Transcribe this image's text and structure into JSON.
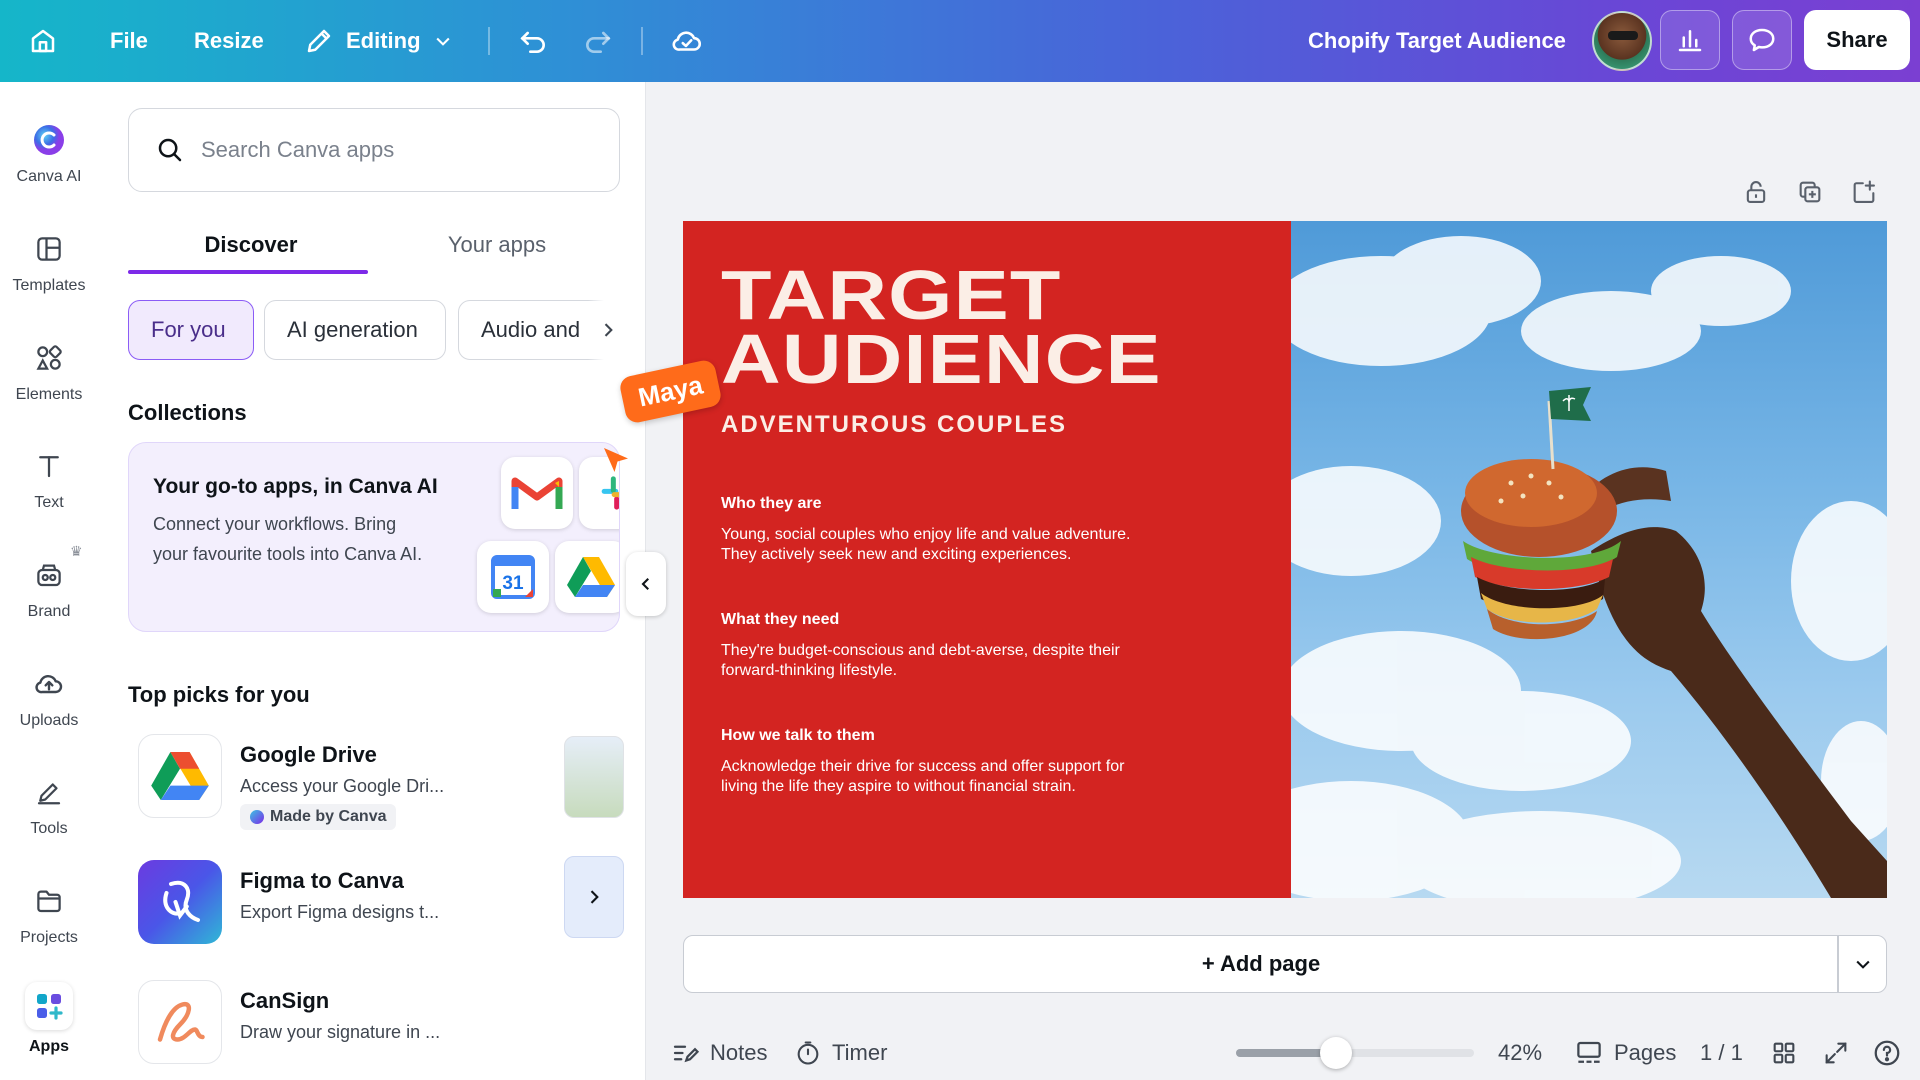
{
  "topbar": {
    "file_label": "File",
    "resize_label": "Resize",
    "editing_label": "Editing",
    "doc_title": "Chopify Target Audience",
    "share_label": "Share"
  },
  "rail": {
    "items": [
      {
        "label": "Canva AI",
        "icon": "canva-ai-icon"
      },
      {
        "label": "Templates",
        "icon": "templates-icon"
      },
      {
        "label": "Elements",
        "icon": "elements-icon"
      },
      {
        "label": "Text",
        "icon": "text-icon"
      },
      {
        "label": "Brand",
        "icon": "brand-icon"
      },
      {
        "label": "Uploads",
        "icon": "uploads-icon"
      },
      {
        "label": "Tools",
        "icon": "tools-icon"
      },
      {
        "label": "Projects",
        "icon": "projects-icon"
      },
      {
        "label": "Apps",
        "icon": "apps-icon"
      }
    ]
  },
  "panel": {
    "search_placeholder": "Search Canva apps",
    "tabs": [
      {
        "label": "Discover"
      },
      {
        "label": "Your apps"
      }
    ],
    "chips": [
      {
        "label": "For you"
      },
      {
        "label": "AI generation"
      },
      {
        "label": "Audio and"
      }
    ],
    "collections_title": "Collections",
    "collection_card": {
      "title": "Your go-to apps, in Canva AI",
      "desc": "Connect your workflows. Bring your favourite tools into Canva AI."
    },
    "top_picks_title": "Top picks for you",
    "picks": [
      {
        "name": "Google Drive",
        "desc": "Access your Google Dri...",
        "badge": "Made by Canva"
      },
      {
        "name": "Figma to Canva",
        "desc": "Export Figma designs t..."
      },
      {
        "name": "CanSign",
        "desc": "Draw your signature in ..."
      }
    ]
  },
  "slide": {
    "title_line1": "TARGET",
    "title_line2": "AUDIENCE",
    "subtitle": "ADVENTUROUS COUPLES",
    "sections": [
      {
        "heading": "Who they are",
        "body": "Young, social couples who enjoy life and value adventure. They actively seek new and exciting experiences."
      },
      {
        "heading": "What they need",
        "body": "They're budget-conscious and debt-averse, despite their forward-thinking lifestyle."
      },
      {
        "heading": "How we talk to them",
        "body": "Acknowledge their drive for success and offer support for living the life they aspire to without financial strain."
      }
    ]
  },
  "collaborator": {
    "name": "Maya",
    "color": "#ff6b1a"
  },
  "canvas": {
    "add_page_label": "+ Add page"
  },
  "footer": {
    "notes_label": "Notes",
    "timer_label": "Timer",
    "zoom_value": "42%",
    "zoom_fraction": 0.42,
    "pages_label": "Pages",
    "page_counter": "1 / 1"
  },
  "colors": {
    "accent": "#7d2ae8",
    "slide_red": "#d32421",
    "topbar_start": "#15b6c9",
    "topbar_end": "#7b3fd2"
  }
}
